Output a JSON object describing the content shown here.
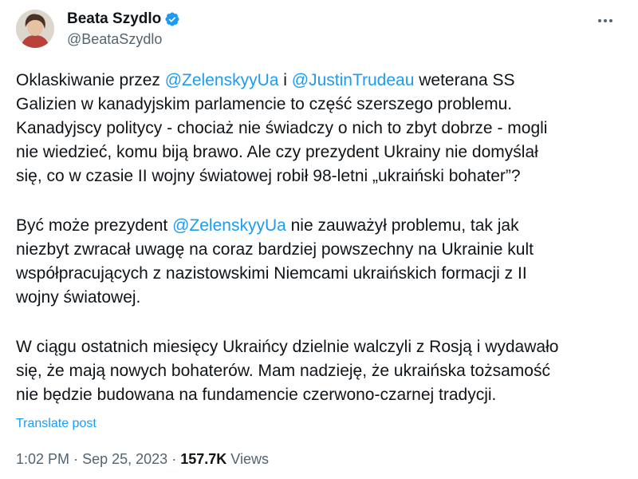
{
  "author": {
    "display_name": "Beata Szydlo",
    "handle": "@BeataSzydlo",
    "verified": true
  },
  "tweet": {
    "paragraphs": [
      {
        "lines": [
          [
            {
              "text": "Oklaskiwanie przez ",
              "mention": false
            },
            {
              "text": "@ZelenskyyUa",
              "mention": true
            },
            {
              "text": " i ",
              "mention": false
            },
            {
              "text": "@JustinTrudeau",
              "mention": true
            },
            {
              "text": " weterana SS",
              "mention": false
            }
          ],
          [
            {
              "text": "Galizien w kanadyjskim parlamencie to część szerszego problemu.",
              "mention": false
            }
          ],
          [
            {
              "text": "Kanadyjscy politycy - chociaż nie świadczy o nich to zbyt dobrze - mogli",
              "mention": false
            }
          ],
          [
            {
              "text": "nie wiedzieć, komu biją brawo. Ale czy prezydent Ukrainy nie domyślał",
              "mention": false
            }
          ],
          [
            {
              "text": "się, co w czasie II wojny światowej robił 98-letni „ukraiński bohater”?",
              "mention": false
            }
          ]
        ]
      },
      {
        "lines": [
          [
            {
              "text": "Być może prezydent ",
              "mention": false
            },
            {
              "text": "@ZelenskyyUa",
              "mention": true
            },
            {
              "text": " nie zauważył problemu, tak jak",
              "mention": false
            }
          ],
          [
            {
              "text": "niezbyt zwracał uwagę na coraz bardziej powszechny na Ukrainie kult",
              "mention": false
            }
          ],
          [
            {
              "text": "współpracujących z nazistowskimi Niemcami ukraińskich formacji z II",
              "mention": false
            }
          ],
          [
            {
              "text": "wojny światowej.",
              "mention": false
            }
          ]
        ]
      },
      {
        "lines": [
          [
            {
              "text": "W ciągu ostatnich miesięcy Ukraińcy dzielnie walczyli z Rosją i wydawało",
              "mention": false
            }
          ],
          [
            {
              "text": "się, że mają nowych bohaterów. Mam nadzieję, że ukraińska tożsamość",
              "mention": false
            }
          ],
          [
            {
              "text": "nie będzie budowana na fundamencie czerwono-czarnej tradycji.",
              "mention": false
            }
          ]
        ]
      }
    ],
    "translate_label": "Translate post",
    "time": "1:02 PM",
    "separator": "·",
    "date": "Sep 25, 2023",
    "views_count": "157.7K",
    "views_label": "Views"
  },
  "icons": {
    "verified": "verified-badge-icon",
    "more": "more-options-icon"
  },
  "colors": {
    "link": "#1d9bf0",
    "text": "#0f1419",
    "muted": "#536471"
  }
}
